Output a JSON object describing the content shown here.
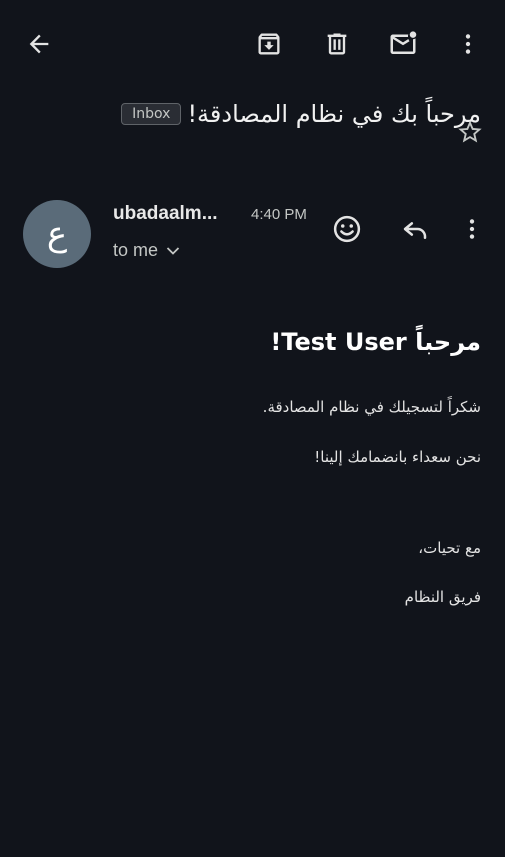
{
  "topbar": {
    "back_icon": "arrow-back-icon",
    "archive_icon": "archive-icon",
    "delete_icon": "trash-icon",
    "unread_icon": "mark-unread-icon",
    "more_icon": "more-vert-icon"
  },
  "message": {
    "subject": "مرحباً بك في نظام المصادقة!",
    "label": "Inbox",
    "starred": false
  },
  "sender": {
    "avatar_letter": "ع",
    "avatar_color": "#5a6b79",
    "name": "ubadaalm...",
    "time": "4:40 PM",
    "recipient": "to me"
  },
  "body": {
    "greeting": "مرحباً Test User!",
    "line1": "شكراً لتسجيلك في نظام المصادقة.",
    "line2": "نحن سعداء بانضمامك إلينا!",
    "line3": "مع تحيات،",
    "line4": "فريق النظام"
  },
  "colors": {
    "background": "#11141b",
    "text": "#e3e3e3",
    "badge_bg": "#2a2d34"
  }
}
